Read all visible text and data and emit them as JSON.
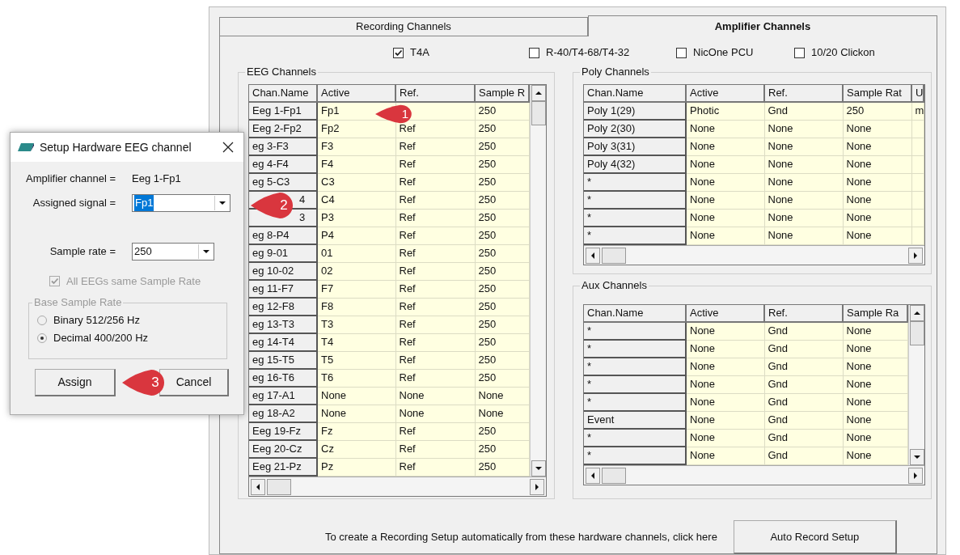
{
  "tabs": [
    {
      "label": "Recording Channels",
      "selected": false
    },
    {
      "label": "Amplifier Channels",
      "selected": true
    }
  ],
  "amplifiers": [
    {
      "label": "T4A",
      "checked": true
    },
    {
      "label": "R-40/T4-68/T4-32",
      "checked": false
    },
    {
      "label": "NicOne PCU",
      "checked": false
    },
    {
      "label": "10/20 Clickon",
      "checked": false
    }
  ],
  "eeg_channels": {
    "title": "EEG Channels",
    "columns": [
      "Chan.Name",
      "Active",
      "Ref.",
      "Sample R"
    ],
    "rows": [
      {
        "name": "Eeg 1-Fp1",
        "active": "Fp1",
        "rate": "250"
      },
      {
        "name": "Eeg 2-Fp2",
        "active": "Fp2",
        "ref": "Ref",
        "rate": "250"
      },
      {
        "name": "eg 3-F3",
        "active": "F3",
        "ref": "Ref",
        "rate": "250"
      },
      {
        "name": "eg 4-F4",
        "active": "F4",
        "ref": "Ref",
        "rate": "250"
      },
      {
        "name": "eg 5-C3",
        "active": "C3",
        "ref": "Ref",
        "rate": "250"
      },
      {
        "name": "4",
        "active": "C4",
        "ref": "Ref",
        "rate": "250"
      },
      {
        "name": "3",
        "active": "P3",
        "ref": "Ref",
        "rate": "250"
      },
      {
        "name": "eg 8-P4",
        "active": "P4",
        "ref": "Ref",
        "rate": "250"
      },
      {
        "name": "eg 9-01",
        "active": "01",
        "ref": "Ref",
        "rate": "250"
      },
      {
        "name": "eg 10-02",
        "active": "02",
        "ref": "Ref",
        "rate": "250"
      },
      {
        "name": "eg 11-F7",
        "active": "F7",
        "ref": "Ref",
        "rate": "250"
      },
      {
        "name": "eg 12-F8",
        "active": "F8",
        "ref": "Ref",
        "rate": "250"
      },
      {
        "name": "eg 13-T3",
        "active": "T3",
        "ref": "Ref",
        "rate": "250"
      },
      {
        "name": "eg 14-T4",
        "active": "T4",
        "ref": "Ref",
        "rate": "250"
      },
      {
        "name": "eg 15-T5",
        "active": "T5",
        "ref": "Ref",
        "rate": "250"
      },
      {
        "name": "eg 16-T6",
        "active": "T6",
        "ref": "Ref",
        "rate": "250"
      },
      {
        "name": "eg 17-A1",
        "active": "None",
        "ref": "None",
        "rate": "None"
      },
      {
        "name": "eg 18-A2",
        "active": "None",
        "ref": "None",
        "rate": "None"
      },
      {
        "name": "Eeg 19-Fz",
        "active": "Fz",
        "ref": "Ref",
        "rate": "250"
      },
      {
        "name": "Eeg 20-Cz",
        "active": "Cz",
        "ref": "Ref",
        "rate": "250"
      },
      {
        "name": "Eeg 21-Pz",
        "active": "Pz",
        "ref": "Ref",
        "rate": "250"
      }
    ]
  },
  "poly_channels": {
    "title": "Poly Channels",
    "columns": [
      "Chan.Name",
      "Active",
      "Ref.",
      "Sample Rat",
      "U"
    ],
    "rows": [
      {
        "name": "Poly 1(29)",
        "active": "Photic",
        "ref": "Gnd",
        "rate": "250",
        "column_5": "m"
      },
      {
        "name": "Poly 2(30)",
        "active": "None",
        "ref": "None",
        "rate": "None"
      },
      {
        "name": "Poly 3(31)",
        "active": "None",
        "ref": "None",
        "rate": "None"
      },
      {
        "name": "Poly 4(32)",
        "active": "None",
        "ref": "None",
        "rate": "None"
      },
      {
        "name": "*",
        "active": "None",
        "ref": "None",
        "rate": "None"
      },
      {
        "name": "*",
        "active": "None",
        "ref": "None",
        "rate": "None"
      },
      {
        "name": "*",
        "active": "None",
        "ref": "None",
        "rate": "None"
      },
      {
        "name": "*",
        "active": "None",
        "ref": "None",
        "rate": "None"
      }
    ]
  },
  "aux_channels": {
    "title": "Aux Channels",
    "columns": [
      "Chan.Name",
      "Active",
      "Ref.",
      "Sample Ra"
    ],
    "rows": [
      {
        "name": "*",
        "active": "None",
        "ref": "Gnd",
        "rate": "None"
      },
      {
        "name": "*",
        "active": "None",
        "ref": "Gnd",
        "rate": "None"
      },
      {
        "name": "*",
        "active": "None",
        "ref": "Gnd",
        "rate": "None"
      },
      {
        "name": "*",
        "active": "None",
        "ref": "Gnd",
        "rate": "None"
      },
      {
        "name": "*",
        "active": "None",
        "ref": "Gnd",
        "rate": "None"
      },
      {
        "name": "Event",
        "active": "None",
        "ref": "Gnd",
        "rate": "None"
      },
      {
        "name": "*",
        "active": "None",
        "ref": "Gnd",
        "rate": "None"
      },
      {
        "name": "*",
        "active": "None",
        "ref": "Gnd",
        "rate": "None"
      }
    ]
  },
  "footer": {
    "text": "To create a Recording Setup automatically from these hardware channels, click here",
    "button": "Auto Record Setup"
  },
  "dialog": {
    "title": "Setup Hardware EEG channel",
    "amplifier_label": "Amplifier channel =",
    "amplifier_value": "Eeg 1-Fp1",
    "assigned_label": "Assigned signal =",
    "assigned_value": "Fp1",
    "assigned_highlighted": true,
    "sample_label": "Sample rate =",
    "sample_value": "250",
    "same_rate": {
      "label": "All EEGs same Sample Rate",
      "checked": true,
      "disabled": true
    },
    "base_rate": {
      "title": "Base Sample Rate",
      "disabled": true,
      "options": [
        {
          "label": "Binary 512/256 Hz",
          "selected": false
        },
        {
          "label": "Decimal 400/200 Hz",
          "selected": true
        }
      ]
    },
    "buttons": [
      "Assign",
      "Cancel"
    ]
  },
  "callouts": [
    "1",
    "2",
    "3"
  ]
}
